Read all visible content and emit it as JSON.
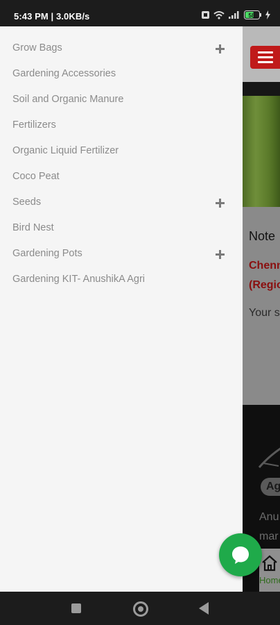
{
  "status_bar": {
    "time": "5:43 PM | 3.0KB/s",
    "battery_level": "58",
    "icons": [
      "alarm-icon",
      "wifi-icon",
      "signal-icon",
      "battery-icon",
      "charging-icon"
    ]
  },
  "drawer": {
    "items": [
      {
        "label": "Grow Bags",
        "expandable": true
      },
      {
        "label": "Gardening Accessories",
        "expandable": false
      },
      {
        "label": "Soil and Organic Manure",
        "expandable": false
      },
      {
        "label": "Fertilizers",
        "expandable": false
      },
      {
        "label": "Organic Liquid Fertilizer",
        "expandable": false
      },
      {
        "label": "Coco Peat",
        "expandable": false
      },
      {
        "label": "Seeds",
        "expandable": true
      },
      {
        "label": "Bird Nest",
        "expandable": false
      },
      {
        "label": "Gardening Pots",
        "expandable": true
      },
      {
        "label": "Gardening KIT- AnushikA Agri",
        "expandable": false
      }
    ]
  },
  "background_page": {
    "note": "Note",
    "red_line_1": "Chenn",
    "red_line_2": "(Regio",
    "your_text": "Your s",
    "badge": "Ag",
    "footer_line_1": "Anu",
    "footer_line_2": "mar",
    "home_label": "Home"
  },
  "colors": {
    "accent_red": "#c01a1a",
    "chat_green": "#1faa4a",
    "drawer_bg": "#f5f5f5",
    "item_text": "#8b8b8b"
  }
}
